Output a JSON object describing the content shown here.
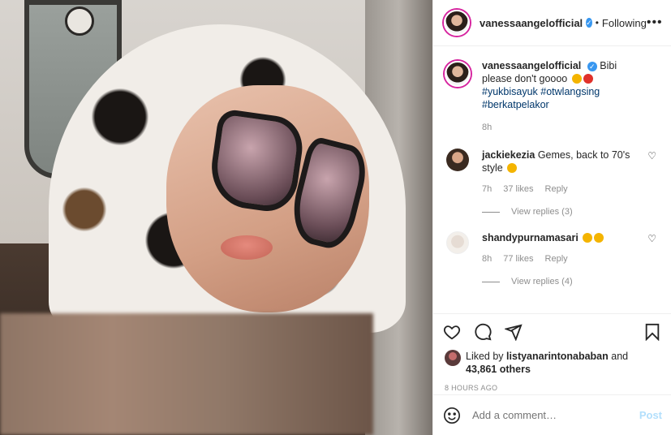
{
  "post": {
    "username": "vanessaangelofficial",
    "verified_icon": "verified-badge-icon",
    "separator": "•",
    "follow_status": "Following",
    "more_icon": "more-horizontal-icon"
  },
  "caption": {
    "username": "vanessaangelofficial",
    "text": "Bibi please don't goooo",
    "hashtags": [
      "#yukbisayuk",
      "#otwlangsing",
      "#berkatpelakor"
    ],
    "time": "8h"
  },
  "comments": [
    {
      "username": "jackiekezia",
      "text": "Gemes, back to 70's style",
      "time": "7h",
      "likes": "37 likes",
      "reply": "Reply",
      "view_replies": "View replies (3)"
    },
    {
      "username": "shandypurnamasari",
      "text": "",
      "time": "8h",
      "likes": "77 likes",
      "reply": "Reply",
      "view_replies": "View replies (4)"
    }
  ],
  "likes": {
    "prefix": "Liked by",
    "user": "listyanarintonababan",
    "and": "and",
    "others": "43,861 others"
  },
  "time_ago": "8 HOURS AGO",
  "comment_box": {
    "placeholder": "Add a comment…",
    "post_label": "Post"
  }
}
